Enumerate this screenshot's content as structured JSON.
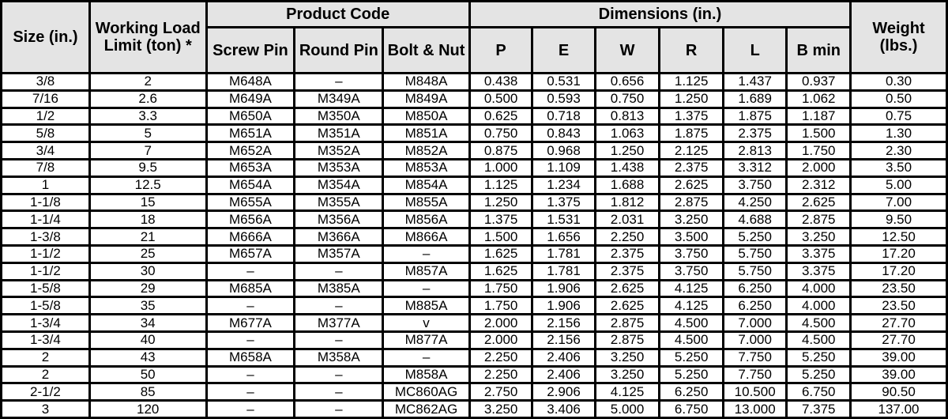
{
  "table": {
    "headers": {
      "size": "Size (in.)",
      "wll": "Working Load Limit (ton) *",
      "product_code": "Product Code",
      "screw_pin": "Screw Pin",
      "round_pin": "Round Pin",
      "bolt_nut": "Bolt & Nut",
      "dimensions": "Dimensions (in.)",
      "p": "P",
      "e": "E",
      "w": "W",
      "r": "R",
      "l": "L",
      "b_min": "B min",
      "weight": "Weight (lbs.)"
    },
    "columns": [
      "size",
      "wll",
      "screw_pin",
      "round_pin",
      "bolt_nut",
      "p",
      "e",
      "w",
      "r",
      "l",
      "b_min",
      "weight"
    ],
    "rows": [
      [
        "3/8",
        "2",
        "M648A",
        "–",
        "M848A",
        "0.438",
        "0.531",
        "0.656",
        "1.125",
        "1.437",
        "0.937",
        "0.30"
      ],
      [
        "7/16",
        "2.6",
        "M649A",
        "M349A",
        "M849A",
        "0.500",
        "0.593",
        "0.750",
        "1.250",
        "1.689",
        "1.062",
        "0.50"
      ],
      [
        "1/2",
        "3.3",
        "M650A",
        "M350A",
        "M850A",
        "0.625",
        "0.718",
        "0.813",
        "1.375",
        "1.875",
        "1.187",
        "0.75"
      ],
      [
        "5/8",
        "5",
        "M651A",
        "M351A",
        "M851A",
        "0.750",
        "0.843",
        "1.063",
        "1.875",
        "2.375",
        "1.500",
        "1.30"
      ],
      [
        "3/4",
        "7",
        "M652A",
        "M352A",
        "M852A",
        "0.875",
        "0.968",
        "1.250",
        "2.125",
        "2.813",
        "1.750",
        "2.30"
      ],
      [
        "7/8",
        "9.5",
        "M653A",
        "M353A",
        "M853A",
        "1.000",
        "1.109",
        "1.438",
        "2.375",
        "3.312",
        "2.000",
        "3.50"
      ],
      [
        "1",
        "12.5",
        "M654A",
        "M354A",
        "M854A",
        "1.125",
        "1.234",
        "1.688",
        "2.625",
        "3.750",
        "2.312",
        "5.00"
      ],
      [
        "1-1/8",
        "15",
        "M655A",
        "M355A",
        "M855A",
        "1.250",
        "1.375",
        "1.812",
        "2.875",
        "4.250",
        "2.625",
        "7.00"
      ],
      [
        "1-1/4",
        "18",
        "M656A",
        "M356A",
        "M856A",
        "1.375",
        "1.531",
        "2.031",
        "3.250",
        "4.688",
        "2.875",
        "9.50"
      ],
      [
        "1-3/8",
        "21",
        "M666A",
        "M366A",
        "M866A",
        "1.500",
        "1.656",
        "2.250",
        "3.500",
        "5.250",
        "3.250",
        "12.50"
      ],
      [
        "1-1/2",
        "25",
        "M657A",
        "M357A",
        "–",
        "1.625",
        "1.781",
        "2.375",
        "3.750",
        "5.750",
        "3.375",
        "17.20"
      ],
      [
        "1-1/2",
        "30",
        "–",
        "–",
        "M857A",
        "1.625",
        "1.781",
        "2.375",
        "3.750",
        "5.750",
        "3.375",
        "17.20"
      ],
      [
        "1-5/8",
        "29",
        "M685A",
        "M385A",
        "–",
        "1.750",
        "1.906",
        "2.625",
        "4.125",
        "6.250",
        "4.000",
        "23.50"
      ],
      [
        "1-5/8",
        "35",
        "–",
        "–",
        "M885A",
        "1.750",
        "1.906",
        "2.625",
        "4.125",
        "6.250",
        "4.000",
        "23.50"
      ],
      [
        "1-3/4",
        "34",
        "M677A",
        "M377A",
        "v",
        "2.000",
        "2.156",
        "2.875",
        "4.500",
        "7.000",
        "4.500",
        "27.70"
      ],
      [
        "1-3/4",
        "40",
        "–",
        "–",
        "M877A",
        "2.000",
        "2.156",
        "2.875",
        "4.500",
        "7.000",
        "4.500",
        "27.70"
      ],
      [
        "2",
        "43",
        "M658A",
        "M358A",
        "–",
        "2.250",
        "2.406",
        "3.250",
        "5.250",
        "7.750",
        "5.250",
        "39.00"
      ],
      [
        "2",
        "50",
        "–",
        "–",
        "M858A",
        "2.250",
        "2.406",
        "3.250",
        "5.250",
        "7.750",
        "5.250",
        "39.00"
      ],
      [
        "2-1/2",
        "85",
        "–",
        "–",
        "MC860AG",
        "2.750",
        "2.906",
        "4.125",
        "6.250",
        "10.500",
        "6.750",
        "90.50"
      ],
      [
        "3",
        "120",
        "–",
        "–",
        "MC862AG",
        "3.250",
        "3.406",
        "5.000",
        "6.750",
        "13.000",
        "7.375",
        "137.00"
      ]
    ]
  }
}
